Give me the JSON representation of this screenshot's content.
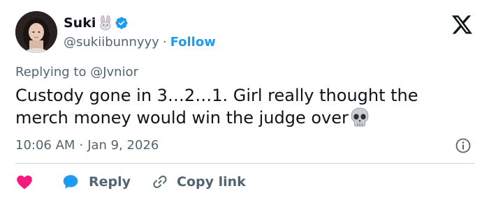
{
  "author": {
    "display_name": "Suki",
    "handle": "@sukiibunnyyy",
    "follow_label": "Follow",
    "separator": "·"
  },
  "tweet": {
    "reply_prefix": "Replying to ",
    "reply_to": "@Jvnior",
    "text": "Custody gone in 3…2…1. Girl really thought the merch money would win the judge over",
    "time": "10:06 AM",
    "date": "Jan 9, 2026",
    "separator": "·"
  },
  "actions": {
    "reply_label": "Reply",
    "copy_label": "Copy link"
  },
  "icons": {
    "platform": "x-logo-icon",
    "name_emoji": "rabbit-icon",
    "verified": "verified-badge-icon",
    "text_emoji": "skull-icon",
    "info": "info-icon",
    "like": "heart-icon",
    "reply": "speech-bubble-icon",
    "copy": "link-icon"
  },
  "colors": {
    "accent": "#1d9bf0",
    "like": "#f91880",
    "text": "#0f1419",
    "muted": "#536471",
    "divider": "#cfd9de"
  }
}
